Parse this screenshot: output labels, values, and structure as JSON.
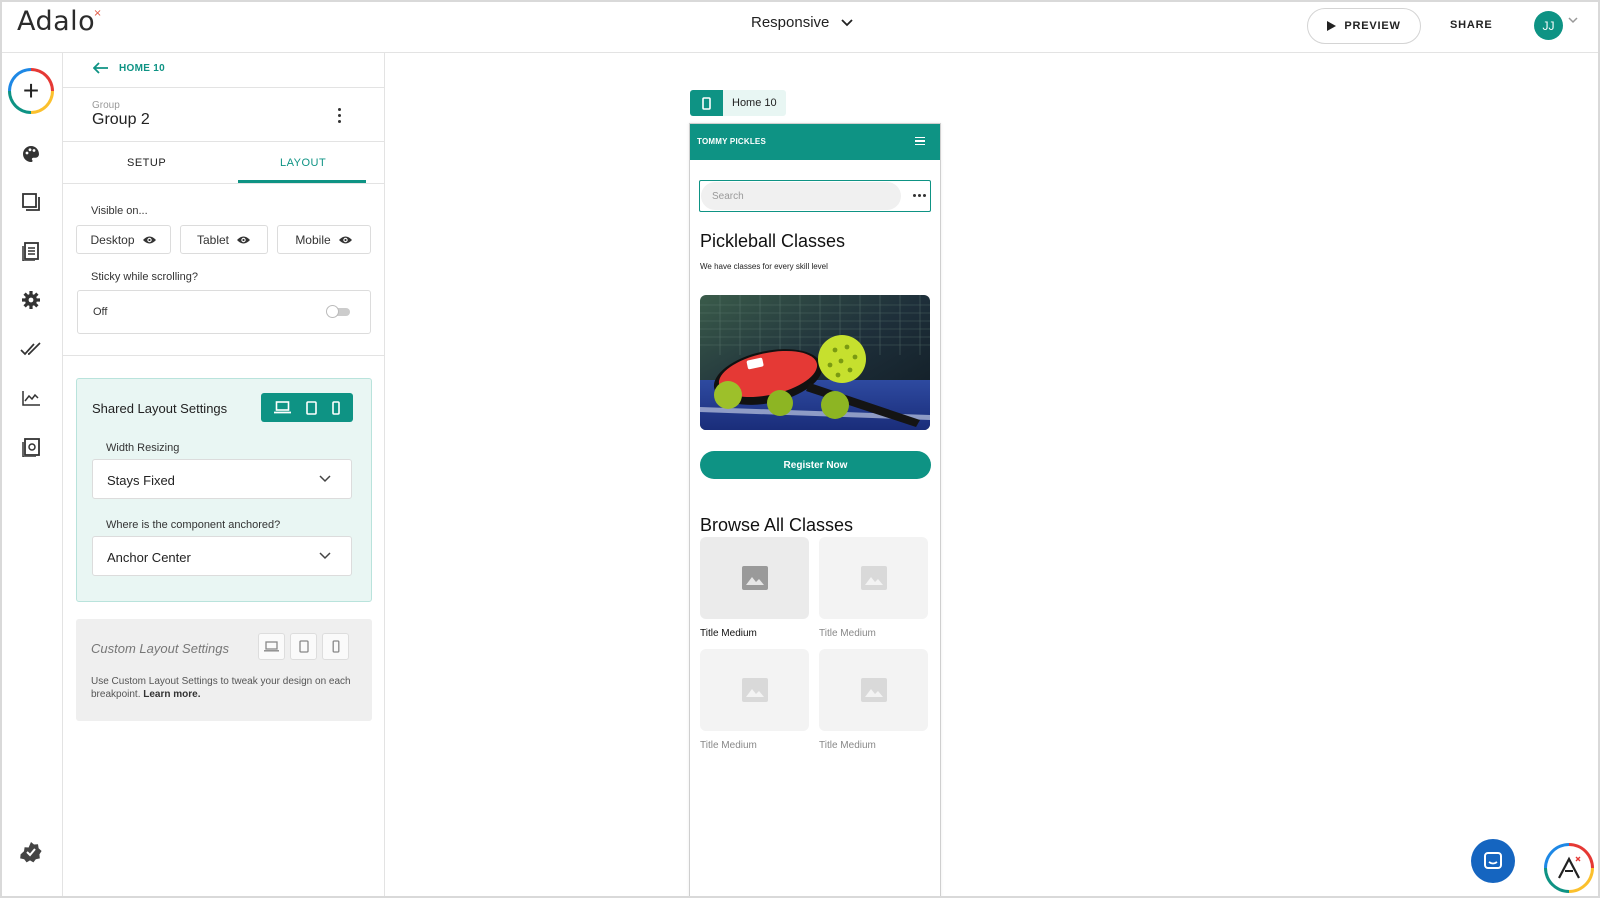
{
  "app": {
    "logo": "Adalo",
    "logo_mark": "×"
  },
  "topbar": {
    "view_mode": "Responsive",
    "preview_label": "PREVIEW",
    "share_label": "SHARE",
    "avatar_initials": "JJ"
  },
  "rail": {
    "icons": [
      "add-icon",
      "palette-icon",
      "screens-icon",
      "database-icon",
      "settings-icon",
      "checkmarks-icon",
      "analytics-icon",
      "publish-icon",
      "verified-badge-icon"
    ]
  },
  "panel": {
    "back_label": "HOME 10",
    "type_label": "Group",
    "component_name": "Group 2",
    "tabs": [
      {
        "label": "SETUP",
        "active": false
      },
      {
        "label": "LAYOUT",
        "active": true
      }
    ],
    "visible_on_label": "Visible on...",
    "visibility": [
      {
        "label": "Desktop"
      },
      {
        "label": "Tablet"
      },
      {
        "label": "Mobile"
      }
    ],
    "sticky_label": "Sticky while scrolling?",
    "sticky_value": "Off",
    "shared": {
      "title": "Shared Layout Settings",
      "width_resizing_label": "Width Resizing",
      "width_resizing_value": "Stays Fixed",
      "anchor_label": "Where is the component anchored?",
      "anchor_value": "Anchor Center"
    },
    "custom": {
      "title": "Custom Layout Settings",
      "description": "Use Custom Layout Settings to tweak your design on each breakpoint.",
      "learn_more": "Learn more."
    }
  },
  "canvas": {
    "screen_name": "Home 10",
    "app_title": "TOMMY PICKLES",
    "search_placeholder": "Search",
    "heading": "Pickleball Classes",
    "subheading": "We have classes for every skill level",
    "register_label": "Register Now",
    "browse_heading": "Browse All Classes",
    "cards": [
      {
        "title": "Title Medium"
      },
      {
        "title": "Title Medium"
      },
      {
        "title": "Title Medium"
      },
      {
        "title": "Title Medium"
      }
    ]
  },
  "colors": {
    "accent": "#0e9384",
    "shared_bg": "#e9f6f3",
    "chat": "#1565c0"
  }
}
